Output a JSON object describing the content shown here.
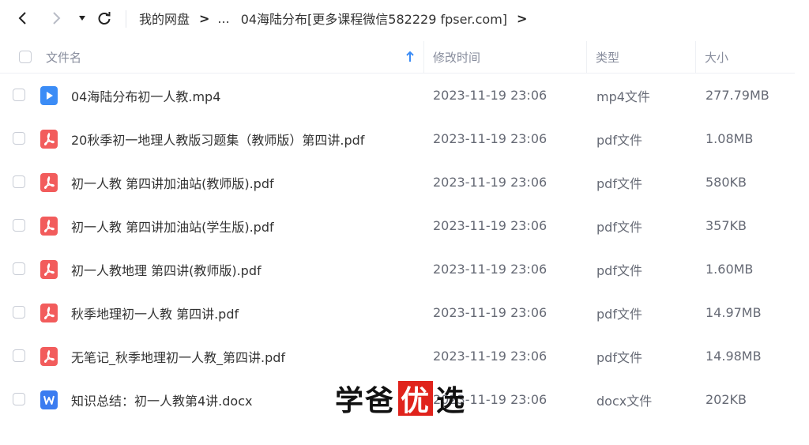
{
  "nav": {
    "breadcrumb": [
      "我的网盘",
      "...",
      "04海陆分布[更多课程微信582229 fpser.com]"
    ]
  },
  "header": {
    "col_name": "文件名",
    "col_time": "修改时间",
    "col_type": "类型",
    "col_size": "大小"
  },
  "files": [
    {
      "name": "04海陆分布初一人教.mp4",
      "time": "2023-11-19 23:06",
      "type": "mp4文件",
      "size": "277.79MB",
      "icon": "video-icon"
    },
    {
      "name": "20秋季初一地理人教版习题集（教师版）第四讲.pdf",
      "time": "2023-11-19 23:06",
      "type": "pdf文件",
      "size": "1.08MB",
      "icon": "pdf-icon"
    },
    {
      "name": "初一人教 第四讲加油站(教师版).pdf",
      "time": "2023-11-19 23:06",
      "type": "pdf文件",
      "size": "580KB",
      "icon": "pdf-icon"
    },
    {
      "name": "初一人教 第四讲加油站(学生版).pdf",
      "time": "2023-11-19 23:06",
      "type": "pdf文件",
      "size": "357KB",
      "icon": "pdf-icon"
    },
    {
      "name": "初一人教地理 第四讲(教师版).pdf",
      "time": "2023-11-19 23:06",
      "type": "pdf文件",
      "size": "1.60MB",
      "icon": "pdf-icon"
    },
    {
      "name": "秋季地理初一人教 第四讲.pdf",
      "time": "2023-11-19 23:06",
      "type": "pdf文件",
      "size": "14.97MB",
      "icon": "pdf-icon"
    },
    {
      "name": "无笔记_秋季地理初一人教_第四讲.pdf",
      "time": "2023-11-19 23:06",
      "type": "pdf文件",
      "size": "14.98MB",
      "icon": "pdf-icon"
    },
    {
      "name": "知识总结：初一人教第4讲.docx",
      "time": "2023-11-19 23:06",
      "type": "docx文件",
      "size": "202KB",
      "icon": "word-icon"
    }
  ],
  "watermark": {
    "char1": "学",
    "char2": "爸",
    "char3": "优",
    "char4": "选"
  },
  "colors": {
    "video": "#3b8cf6",
    "pdf": "#f25c5c",
    "word": "#3b7cf0",
    "sort_arrow": "#3b8cf6"
  }
}
